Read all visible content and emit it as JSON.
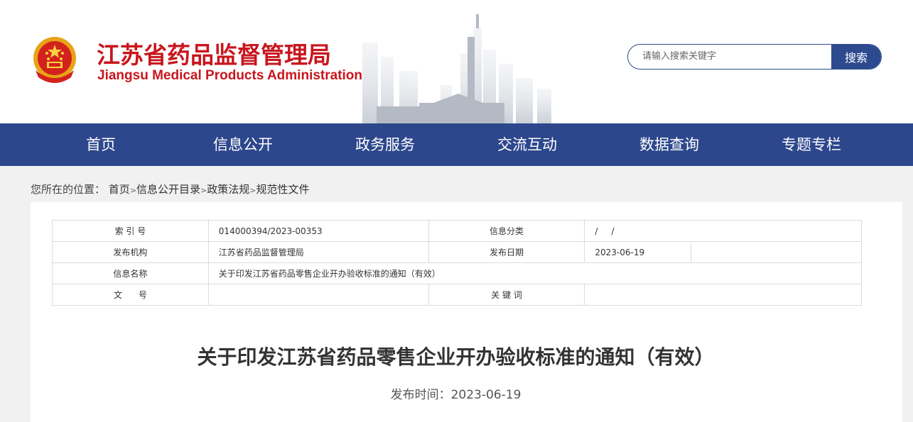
{
  "header": {
    "title_cn": "江苏省药品监督管理局",
    "title_en": "Jiangsu Medical Products Administration",
    "brand_color": "#c8161d",
    "emblem_icon": "national-emblem-icon"
  },
  "search": {
    "placeholder": "请输入搜索关键字",
    "button_label": "搜索"
  },
  "nav": {
    "items": [
      "首页",
      "信息公开",
      "政务服务",
      "交流互动",
      "数据查询",
      "专题专栏"
    ],
    "background": "#2d478d"
  },
  "breadcrumb": {
    "prefix": "您所在的位置：",
    "items": [
      "首页",
      "信息公开目录",
      "政策法规",
      "规范性文件"
    ],
    "separator": ">"
  },
  "meta": {
    "index_label": "索 引 号",
    "index_value": "014000394/2023-00353",
    "category_label": "信息分类",
    "category_value": "/     /",
    "publisher_label": "发布机构",
    "publisher_value": "江苏省药品监督管理局",
    "publish_date_label": "发布日期",
    "publish_date_value": "2023-06-19",
    "name_label": "信息名称",
    "name_value": "关于印发江苏省药品零售企业开办验收标准的通知（有效）",
    "doc_no_label": "文      号",
    "doc_no_value": "",
    "keywords_label": "关 键 词",
    "keywords_value": ""
  },
  "article": {
    "title": "关于印发江苏省药品零售企业开办验收标准的通知（有效）",
    "date_text": "发布时间：2023-06-19"
  }
}
